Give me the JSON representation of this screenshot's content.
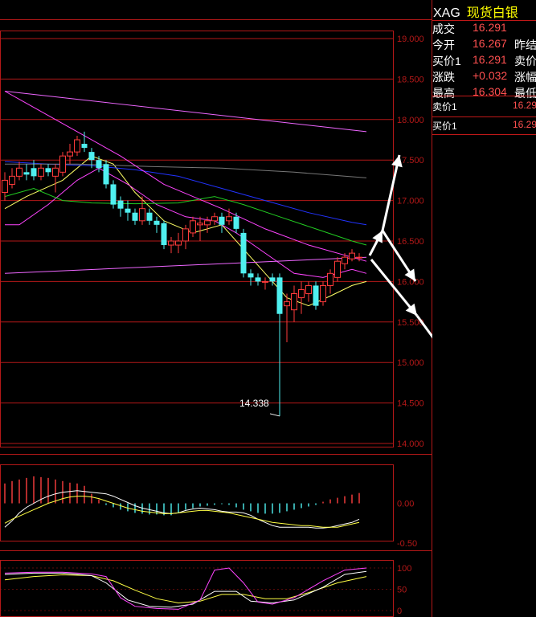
{
  "quote": {
    "symbol": "XAG",
    "name": "现货白银",
    "rows": [
      {
        "label": "成交",
        "value": "16.291",
        "label2": ""
      },
      {
        "label": "今开",
        "value": "16.267",
        "label2": "昨结"
      },
      {
        "label": "买价1",
        "value": "16.291",
        "label2": "卖价"
      },
      {
        "label": "涨跌",
        "value": "+0.032",
        "label2": "涨幅"
      },
      {
        "label": "最高",
        "value": "16.304",
        "label2": "最低"
      }
    ],
    "sell": {
      "label": "卖价1",
      "value": "16.29"
    },
    "buy": {
      "label": "买价1",
      "value": "16.29"
    }
  },
  "chart_data": [
    {
      "type": "candlestick",
      "ylim": [
        14.0,
        19.0
      ],
      "y_ticks": [
        "19.000",
        "18.500",
        "18.000",
        "17.500",
        "17.000",
        "16.500",
        "16.000",
        "15.500",
        "15.000",
        "14.500",
        "14.000"
      ],
      "low_annotation": "14.338",
      "candles": [
        [
          17.1,
          17.25,
          17.0,
          17.35
        ],
        [
          17.2,
          17.3,
          17.15,
          17.4
        ],
        [
          17.3,
          17.4,
          17.25,
          17.48
        ],
        [
          17.35,
          17.32,
          17.25,
          17.45
        ],
        [
          17.4,
          17.3,
          17.25,
          17.5
        ],
        [
          17.3,
          17.4,
          17.25,
          17.45
        ],
        [
          17.4,
          17.35,
          17.3,
          17.45
        ],
        [
          17.3,
          17.4,
          17.1,
          17.45
        ],
        [
          17.35,
          17.55,
          17.3,
          17.6
        ],
        [
          17.55,
          17.6,
          17.45,
          17.7
        ],
        [
          17.6,
          17.75,
          17.55,
          17.8
        ],
        [
          17.7,
          17.65,
          17.6,
          17.85
        ],
        [
          17.6,
          17.5,
          17.4,
          17.65
        ],
        [
          17.5,
          17.4,
          17.35,
          17.55
        ],
        [
          17.45,
          17.2,
          17.15,
          17.5
        ],
        [
          17.2,
          16.95,
          16.9,
          17.25
        ],
        [
          17.0,
          16.9,
          16.8,
          17.05
        ],
        [
          16.9,
          16.85,
          16.75,
          17.0
        ],
        [
          16.85,
          16.75,
          16.7,
          16.9
        ],
        [
          16.75,
          16.9,
          16.7,
          17.05
        ],
        [
          16.85,
          16.75,
          16.7,
          16.9
        ],
        [
          16.75,
          16.7,
          16.6,
          16.8
        ],
        [
          16.72,
          16.45,
          16.4,
          16.75
        ],
        [
          16.45,
          16.5,
          16.35,
          16.55
        ],
        [
          16.45,
          16.5,
          16.35,
          16.6
        ],
        [
          16.5,
          16.65,
          16.4,
          16.7
        ],
        [
          16.6,
          16.75,
          16.55,
          16.8
        ],
        [
          16.7,
          16.72,
          16.5,
          16.8
        ],
        [
          16.7,
          16.75,
          16.6,
          16.8
        ],
        [
          16.75,
          16.8,
          16.7,
          16.85
        ],
        [
          16.8,
          16.7,
          16.6,
          16.85
        ],
        [
          16.75,
          16.8,
          16.7,
          16.9
        ],
        [
          16.8,
          16.65,
          16.6,
          16.85
        ],
        [
          16.6,
          16.1,
          16.05,
          16.65
        ],
        [
          16.1,
          16.05,
          15.95,
          16.15
        ],
        [
          16.05,
          16.0,
          15.95,
          16.1
        ],
        [
          16.0,
          16.0,
          15.9,
          16.05
        ],
        [
          16.05,
          16.0,
          15.95,
          16.1
        ],
        [
          16.05,
          15.6,
          14.338,
          16.1
        ],
        [
          15.7,
          15.75,
          15.25,
          15.85
        ],
        [
          15.65,
          15.85,
          15.5,
          15.95
        ],
        [
          15.8,
          15.9,
          15.6,
          16.0
        ],
        [
          15.85,
          15.95,
          15.75,
          16.0
        ],
        [
          15.95,
          15.7,
          15.65,
          16.0
        ],
        [
          15.75,
          15.95,
          15.7,
          16.0
        ],
        [
          15.95,
          16.1,
          15.85,
          16.15
        ],
        [
          16.05,
          16.25,
          16.0,
          16.3
        ],
        [
          16.22,
          16.3,
          16.15,
          16.35
        ],
        [
          16.28,
          16.35,
          16.25,
          16.4
        ],
        [
          16.3,
          16.3,
          16.25,
          16.35
        ]
      ],
      "ma_lines": [
        {
          "color": "#ffff66",
          "values": [
            [
              0,
              16.9
            ],
            [
              3,
              17.05
            ],
            [
              8,
              17.25
            ],
            [
              12,
              17.55
            ],
            [
              15,
              17.45
            ],
            [
              18,
              17.1
            ],
            [
              22,
              16.75
            ],
            [
              26,
              16.6
            ],
            [
              30,
              16.7
            ],
            [
              33,
              16.4
            ],
            [
              36,
              16.1
            ],
            [
              39,
              15.8
            ],
            [
              42,
              15.7
            ],
            [
              45,
              15.82
            ],
            [
              48,
              15.95
            ],
            [
              50,
              16.0
            ]
          ]
        },
        {
          "color": "#ff44ff",
          "values": [
            [
              0,
              16.7
            ],
            [
              2,
              16.7
            ],
            [
              6,
              16.95
            ],
            [
              10,
              17.25
            ],
            [
              13,
              17.4
            ],
            [
              17,
              17.2
            ],
            [
              21,
              16.95
            ],
            [
              25,
              16.8
            ],
            [
              29,
              16.75
            ],
            [
              32,
              16.6
            ],
            [
              36,
              16.35
            ],
            [
              40,
              16.1
            ],
            [
              44,
              16.05
            ],
            [
              48,
              16.15
            ],
            [
              50,
              16.1
            ]
          ]
        },
        {
          "color": "#22cc22",
          "values": [
            [
              0,
              17.05
            ],
            [
              4,
              17.15
            ],
            [
              8,
              17.0
            ],
            [
              12,
              16.97
            ],
            [
              18,
              16.96
            ],
            [
              24,
              16.97
            ],
            [
              29,
              17.05
            ],
            [
              33,
              16.95
            ],
            [
              38,
              16.8
            ],
            [
              43,
              16.65
            ],
            [
              48,
              16.5
            ],
            [
              50,
              16.45
            ]
          ]
        },
        {
          "color": "#2233ff",
          "values": [
            [
              0,
              17.48
            ],
            [
              6,
              17.45
            ],
            [
              12,
              17.43
            ],
            [
              18,
              17.38
            ],
            [
              24,
              17.3
            ],
            [
              30,
              17.15
            ],
            [
              36,
              17.0
            ],
            [
              42,
              16.85
            ],
            [
              48,
              16.73
            ],
            [
              50,
              16.7
            ]
          ]
        },
        {
          "color": "#777777",
          "values": [
            [
              0,
              17.45
            ],
            [
              10,
              17.45
            ],
            [
              20,
              17.42
            ],
            [
              30,
              17.4
            ],
            [
              40,
              17.35
            ],
            [
              50,
              17.28
            ]
          ]
        },
        {
          "color": "#ee66ff",
          "values": [
            [
              0,
              18.35
            ],
            [
              50,
              17.85
            ]
          ]
        },
        {
          "color": "#ee66ff",
          "values": [
            [
              0,
              16.1
            ],
            [
              50,
              16.3
            ]
          ]
        },
        {
          "color": "#ff44ff",
          "values": [
            [
              0,
              18.35
            ],
            [
              8,
              17.95
            ],
            [
              16,
              17.55
            ],
            [
              22,
              17.2
            ],
            [
              30,
              16.9
            ],
            [
              36,
              16.65
            ],
            [
              42,
              16.45
            ],
            [
              48,
              16.3
            ],
            [
              50,
              16.25
            ]
          ]
        }
      ]
    },
    {
      "type": "macd",
      "ylim": [
        -0.5,
        0.45
      ],
      "y_ticks": [
        "0.00",
        "-0.50"
      ],
      "histogram": [
        0.25,
        0.28,
        0.3,
        0.32,
        0.34,
        0.33,
        0.32,
        0.3,
        0.28,
        0.26,
        0.25,
        0.22,
        0.12,
        0.05,
        -0.02,
        -0.05,
        -0.08,
        -0.1,
        -0.12,
        -0.13,
        -0.14,
        -0.14,
        -0.15,
        -0.15,
        -0.12,
        -0.08,
        -0.06,
        -0.04,
        -0.03,
        -0.02,
        -0.01,
        -0.02,
        -0.05,
        -0.08,
        -0.1,
        -0.12,
        -0.13,
        -0.13,
        -0.12,
        -0.1,
        -0.08,
        -0.06,
        -0.04,
        -0.02,
        0.02,
        0.05,
        0.07,
        0.09,
        0.11,
        0.13
      ],
      "dif": [
        -0.3,
        -0.22,
        -0.12,
        -0.05,
        0.0,
        0.05,
        0.09,
        0.12,
        0.14,
        0.15,
        0.16,
        0.15,
        0.14,
        0.13,
        0.12,
        0.09,
        0.05,
        0.01,
        -0.03,
        -0.06,
        -0.08,
        -0.1,
        -0.12,
        -0.13,
        -0.12,
        -0.09,
        -0.07,
        -0.06,
        -0.07,
        -0.08,
        -0.1,
        -0.11,
        -0.11,
        -0.12,
        -0.15,
        -0.2,
        -0.24,
        -0.28,
        -0.3,
        -0.3,
        -0.3,
        -0.3,
        -0.3,
        -0.31,
        -0.31,
        -0.3,
        -0.28,
        -0.26,
        -0.24,
        -0.2
      ],
      "dea": [
        -0.25,
        -0.2,
        -0.16,
        -0.12,
        -0.08,
        -0.04,
        0.0,
        0.03,
        0.06,
        0.08,
        0.09,
        0.09,
        0.08,
        0.06,
        0.03,
        0.0,
        -0.03,
        -0.06,
        -0.08,
        -0.1,
        -0.11,
        -0.12,
        -0.13,
        -0.13,
        -0.12,
        -0.11,
        -0.1,
        -0.09,
        -0.09,
        -0.1,
        -0.11,
        -0.12,
        -0.14,
        -0.16,
        -0.18,
        -0.2,
        -0.22,
        -0.24,
        -0.25,
        -0.26,
        -0.27,
        -0.28,
        -0.28,
        -0.29,
        -0.3,
        -0.3,
        -0.3,
        -0.28,
        -0.26,
        -0.24
      ]
    },
    {
      "type": "kdj",
      "ylim": [
        0,
        100
      ],
      "y_ticks": [
        "100",
        "50",
        "0"
      ],
      "k": [
        [
          0,
          85
        ],
        [
          4,
          88
        ],
        [
          8,
          88
        ],
        [
          12,
          82
        ],
        [
          14,
          65
        ],
        [
          17,
          25
        ],
        [
          20,
          10
        ],
        [
          23,
          8
        ],
        [
          26,
          15
        ],
        [
          29,
          45
        ],
        [
          32,
          45
        ],
        [
          34,
          22
        ],
        [
          37,
          18
        ],
        [
          40,
          25
        ],
        [
          44,
          55
        ],
        [
          47,
          85
        ],
        [
          50,
          92
        ]
      ],
      "d": [
        [
          0,
          72
        ],
        [
          4,
          80
        ],
        [
          8,
          84
        ],
        [
          12,
          82
        ],
        [
          15,
          70
        ],
        [
          18,
          48
        ],
        [
          21,
          28
        ],
        [
          24,
          18
        ],
        [
          27,
          22
        ],
        [
          30,
          38
        ],
        [
          33,
          38
        ],
        [
          36,
          28
        ],
        [
          39,
          28
        ],
        [
          42,
          42
        ],
        [
          46,
          65
        ],
        [
          50,
          80
        ]
      ],
      "j": [
        [
          0,
          88
        ],
        [
          4,
          90
        ],
        [
          8,
          90
        ],
        [
          12,
          86
        ],
        [
          14,
          80
        ],
        [
          16,
          30
        ],
        [
          18,
          10
        ],
        [
          21,
          5
        ],
        [
          24,
          3
        ],
        [
          27,
          25
        ],
        [
          29,
          95
        ],
        [
          31,
          100
        ],
        [
          33,
          65
        ],
        [
          35,
          20
        ],
        [
          37,
          15
        ],
        [
          40,
          30
        ],
        [
          44,
          70
        ],
        [
          47,
          95
        ],
        [
          50,
          100
        ]
      ]
    }
  ]
}
